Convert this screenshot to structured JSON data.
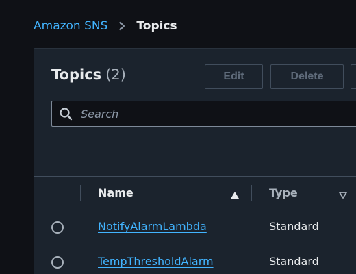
{
  "breadcrumb": {
    "parent_label": "Amazon SNS",
    "separator_icon": "chevron-right-icon",
    "current_label": "Topics"
  },
  "header": {
    "title": "Topics",
    "count": "(2)"
  },
  "toolbar": {
    "edit_label": "Edit",
    "delete_label": "Delete",
    "buttons_disabled": true
  },
  "search": {
    "placeholder": "Search",
    "value": ""
  },
  "table": {
    "columns": [
      {
        "label": "Name",
        "sort": "ascending",
        "sort_icon": "caret-up-icon"
      },
      {
        "label": "Type",
        "sort": "none",
        "sort_icon": "caret-down-outline-icon"
      }
    ],
    "rows": [
      {
        "name": "NotifyAlarmLambda",
        "type": "Standard",
        "selected": false
      },
      {
        "name": "TempThresholdAlarm",
        "type": "Standard",
        "selected": false
      }
    ]
  },
  "colors": {
    "page_background": "#0f1116",
    "panel_background": "#1b232d",
    "link": "#42b4ff",
    "text_primary": "#e9ebed",
    "text_secondary": "#a8b1bb",
    "border": "#414d5c"
  }
}
